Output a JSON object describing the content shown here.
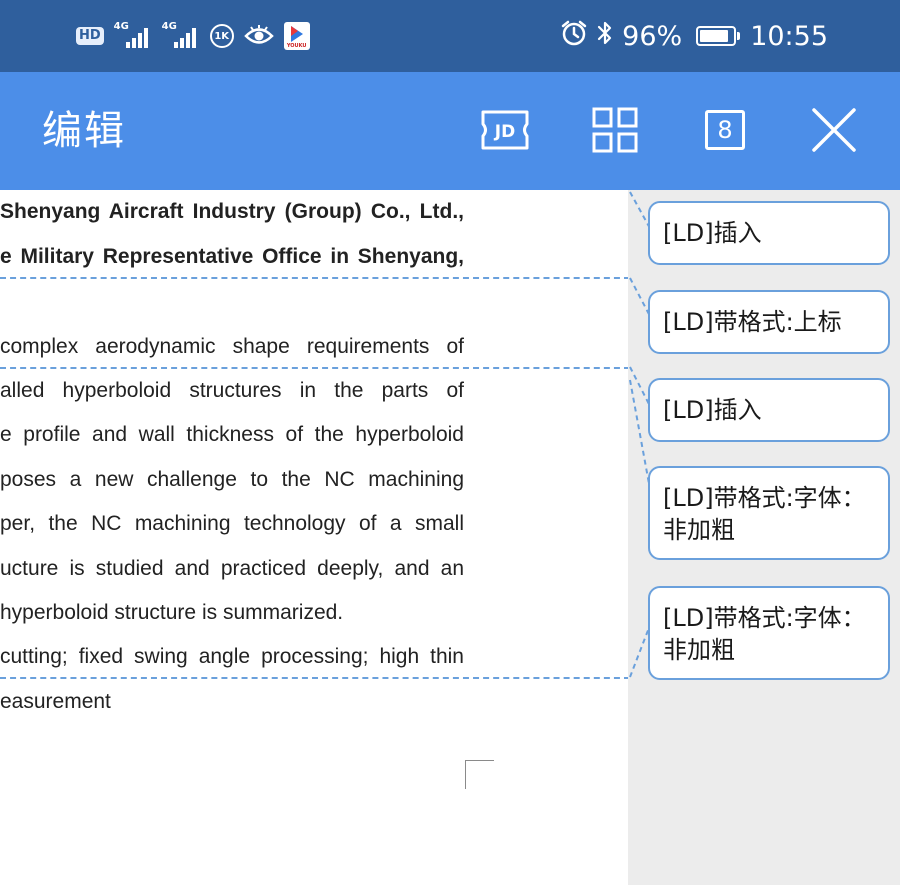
{
  "status_bar": {
    "hd_label": "HD",
    "signal1_tag": "4G",
    "signal2_tag": "4G",
    "data_saver_label": "1K",
    "app_badge_label": "YOUKU",
    "battery_percent": "96%",
    "time": "10:55",
    "icons": [
      "alarm-icon",
      "bluetooth-icon",
      "battery-icon",
      "eye-icon"
    ]
  },
  "header": {
    "title": "编辑",
    "jd_label": "JD",
    "count": "8",
    "icons": [
      "jd-icon",
      "grid-icon",
      "close-icon"
    ]
  },
  "document": {
    "lines": [
      "Shenyang Aircraft Industry (Group) Co., Ltd.,",
      "e Military Representative Office in Shenyang,",
      "complex aerodynamic shape requirements of",
      "alled hyperboloid structures in the parts of",
      "e profile and wall thickness of the hyperboloid",
      "poses a new challenge to the NC machining",
      "per, the NC machining technology of a small",
      "ucture is studied and practiced deeply, and an",
      "hyperboloid structure is summarized.",
      "cutting; fixed swing angle processing; high thin",
      "easurement"
    ]
  },
  "comments": [
    {
      "text": "[LD]插入"
    },
    {
      "text": "[LD]带格式:上标"
    },
    {
      "text": "[LD]插入"
    },
    {
      "text": "[LD]带格式:字体：非加粗"
    },
    {
      "text": "[LD]带格式:字体：非加粗"
    }
  ],
  "colors": {
    "status_bar_bg": "#2f5f9d",
    "header_bg": "#4c8ee8",
    "panel_bg": "#ececec",
    "accent_border": "#6aa0dc"
  }
}
